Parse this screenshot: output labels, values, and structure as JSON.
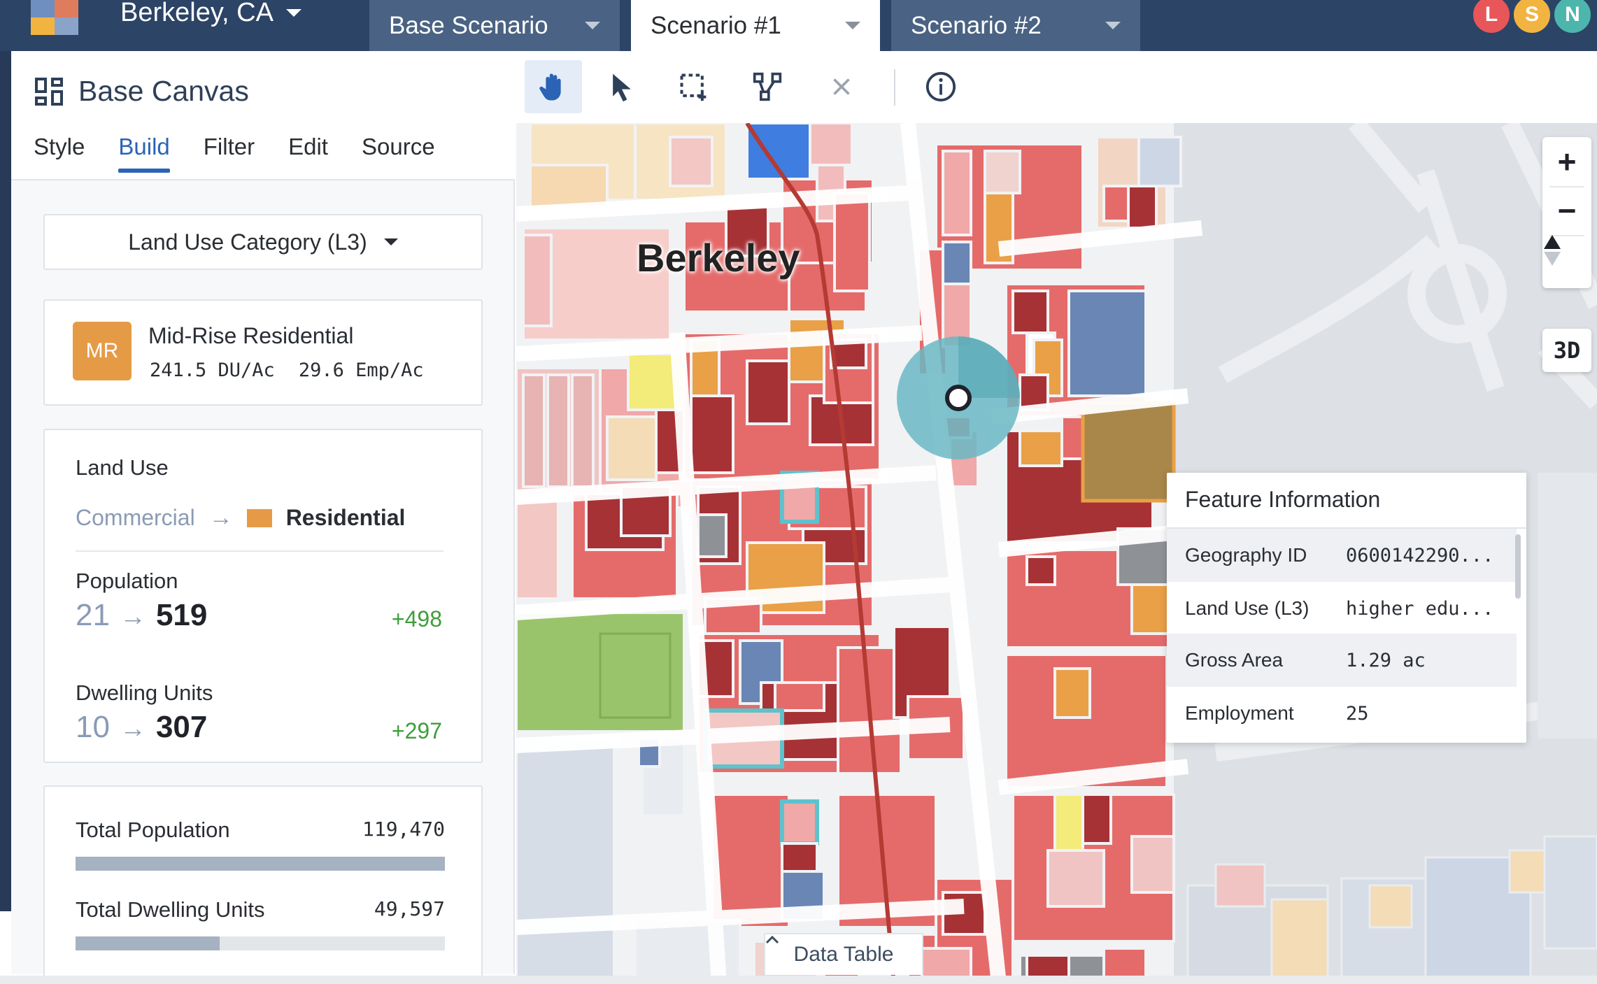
{
  "app": {
    "city": "Berkeley, CA",
    "logo_colors": [
      "#e07c5e",
      "#8aa3c9",
      "#f2b441",
      "#6f8fc0"
    ]
  },
  "scenario_tabs": [
    {
      "label": "Base Scenario",
      "active": false
    },
    {
      "label": "Scenario #1",
      "active": true
    },
    {
      "label": "Scenario #2",
      "active": false
    }
  ],
  "avatars": [
    {
      "initial": "L",
      "color": "#e8565a"
    },
    {
      "initial": "S",
      "color": "#f2b441"
    },
    {
      "initial": "N",
      "color": "#4db6ac"
    }
  ],
  "panel": {
    "title": "Base Canvas",
    "title_icon": "dashboard-grid-icon",
    "tabs": [
      {
        "label": "Style",
        "active": false
      },
      {
        "label": "Build",
        "active": true
      },
      {
        "label": "Filter",
        "active": false
      },
      {
        "label": "Edit",
        "active": false
      },
      {
        "label": "Source",
        "active": false
      }
    ],
    "category_dropdown": "Land Use Category (L3)",
    "building_type": {
      "badge": "MR",
      "name": "Mid-Rise Residential",
      "du_per_acre": "241.5 DU/Ac",
      "emp_per_acre": "29.6 Emp/Ac",
      "badge_color": "#e59b46"
    },
    "land_use": {
      "label": "Land Use",
      "from": "Commercial",
      "to": "Residential",
      "to_color": "#e59b46"
    },
    "population": {
      "label": "Population",
      "from": "21",
      "to": "519",
      "delta": "+498"
    },
    "dwelling_units": {
      "label": "Dwelling Units",
      "from": "10",
      "to": "307",
      "delta": "+297"
    },
    "totals": [
      {
        "label": "Total Population",
        "value": "119,470",
        "fill": 1.0
      },
      {
        "label": "Total Dwelling Units",
        "value": "49,597",
        "fill": 0.39
      }
    ]
  },
  "toolbar": {
    "tools": [
      {
        "name": "pan-hand-icon",
        "active": true
      },
      {
        "name": "select-pointer-icon",
        "active": false
      },
      {
        "name": "box-select-icon",
        "active": false
      },
      {
        "name": "polygon-vertex-icon",
        "active": false
      },
      {
        "name": "clear-x-icon",
        "active": false
      },
      {
        "name": "info-icon",
        "active": false
      }
    ]
  },
  "map": {
    "city_label": "Berkeley",
    "zoom_in": "+",
    "zoom_out": "−",
    "btn_3d": "3D",
    "data_table_label": "Data Table",
    "feature_info": {
      "title": "Feature Information",
      "rows": [
        {
          "key": "Geography ID",
          "value": "0600142290..."
        },
        {
          "key": "Land Use (L3)",
          "value": "higher edu..."
        },
        {
          "key": "Gross Area",
          "value": "1.29 ac"
        },
        {
          "key": "Employment",
          "value": "25"
        }
      ]
    },
    "colors": {
      "residential_red": "#e56b6b",
      "residential_pink": "#f0a8a8",
      "dark_red": "#a63236",
      "orange": "#e9a047",
      "yellow": "#f3eb7a",
      "blue": "#6986b5",
      "bright_blue": "#3f7de0",
      "green": "#9ac46b",
      "brown": "#a9874a",
      "tan": "#f3dcb6",
      "grey": "#8e9196",
      "cyan_outline": "#5ec2cc",
      "transit_line": "#b43a34"
    }
  }
}
